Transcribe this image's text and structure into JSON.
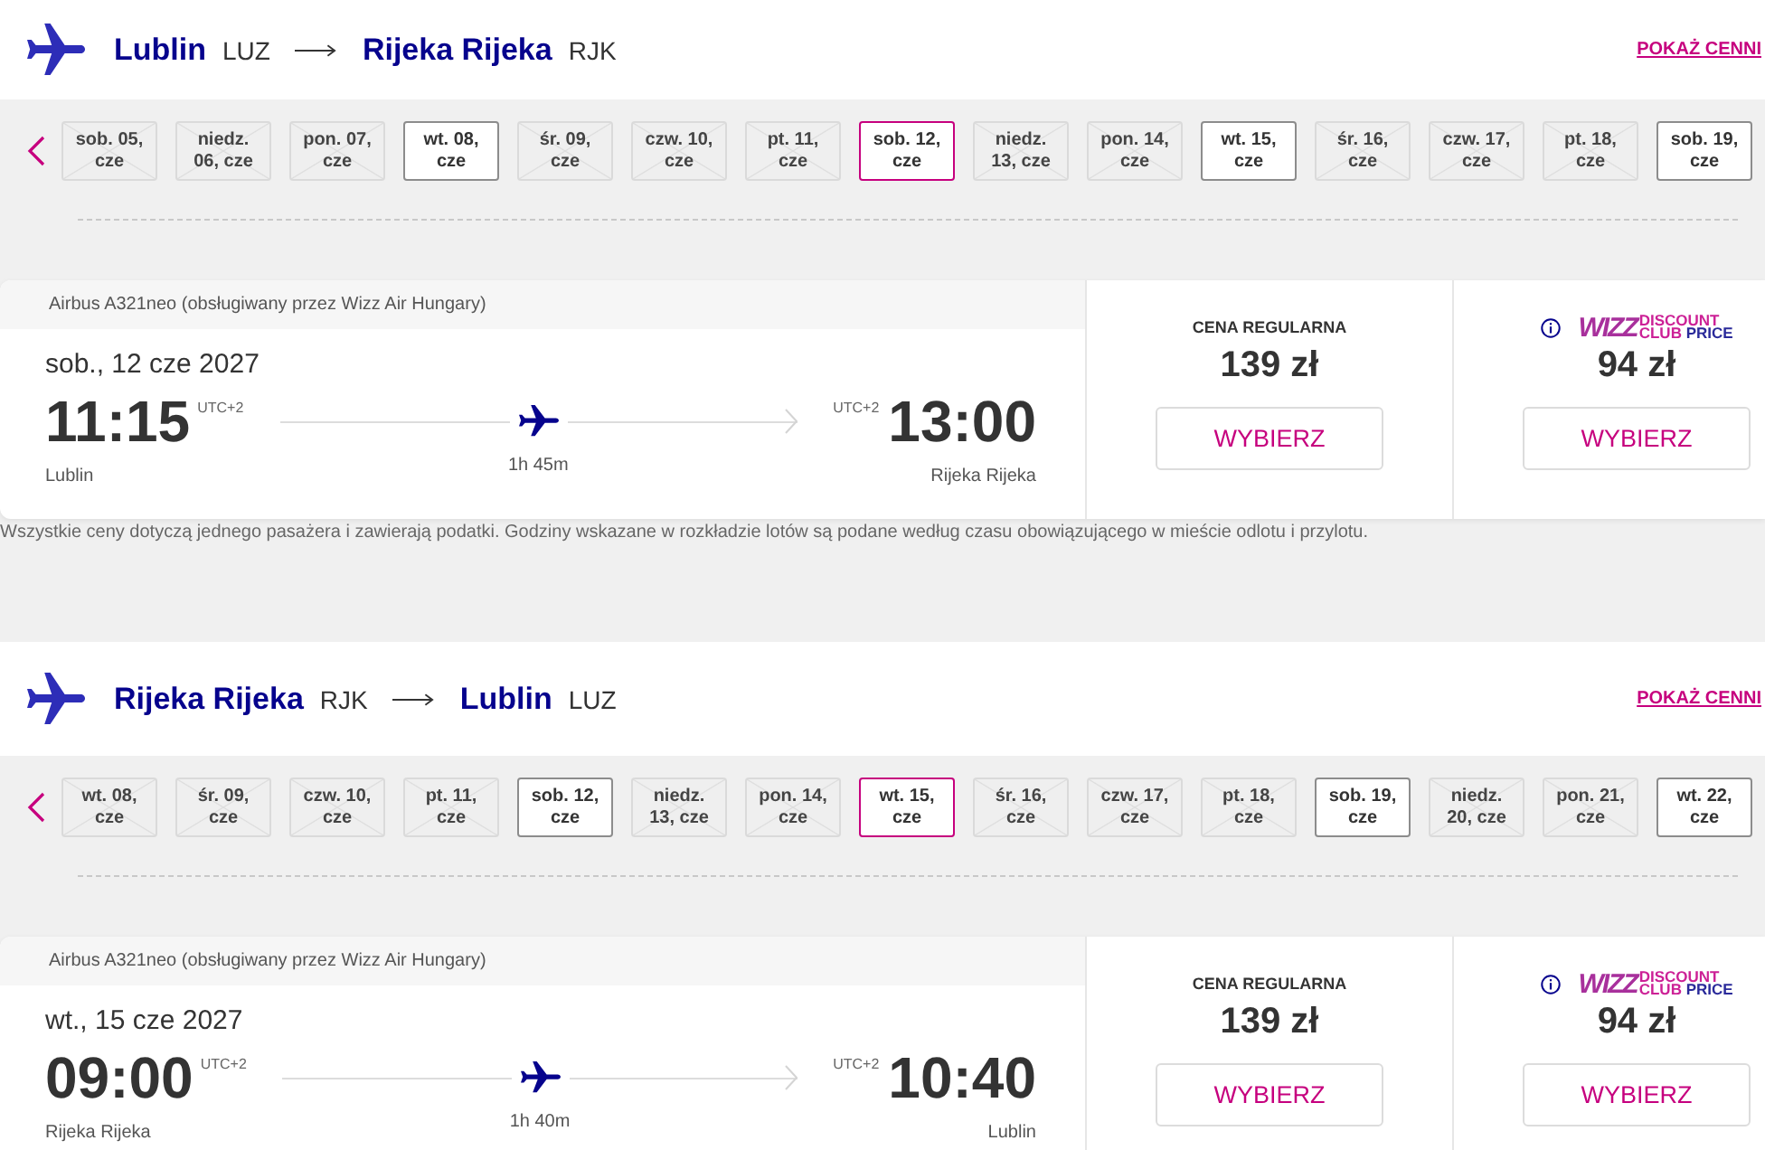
{
  "flights": [
    {
      "header": {
        "origin": {
          "city": "Lublin",
          "code": "LUZ"
        },
        "destination": {
          "city": "Rijeka Rijeka",
          "code": "RJK"
        },
        "link": "POKAŻ CENNI"
      },
      "dates": [
        {
          "label": "sob. 05, cze",
          "available": false,
          "selected": false
        },
        {
          "label": "niedz. 06, cze",
          "available": false,
          "selected": false
        },
        {
          "label": "pon. 07, cze",
          "available": false,
          "selected": false
        },
        {
          "label": "wt. 08, cze",
          "available": true,
          "selected": false
        },
        {
          "label": "śr. 09, cze",
          "available": false,
          "selected": false
        },
        {
          "label": "czw. 10, cze",
          "available": false,
          "selected": false
        },
        {
          "label": "pt. 11, cze",
          "available": false,
          "selected": false
        },
        {
          "label": "sob. 12, cze",
          "available": true,
          "selected": true
        },
        {
          "label": "niedz. 13, cze",
          "available": false,
          "selected": false
        },
        {
          "label": "pon. 14, cze",
          "available": false,
          "selected": false
        },
        {
          "label": "wt. 15, cze",
          "available": true,
          "selected": false
        },
        {
          "label": "śr. 16, cze",
          "available": false,
          "selected": false
        },
        {
          "label": "czw. 17, cze",
          "available": false,
          "selected": false
        },
        {
          "label": "pt. 18, cze",
          "available": false,
          "selected": false
        },
        {
          "label": "sob. 19, cze",
          "available": true,
          "selected": false
        }
      ],
      "card": {
        "aircraft": "Airbus A321neo (obsługiwany przez Wizz Air Hungary)",
        "date": "sob., 12 cze 2027",
        "departure": {
          "time": "11:15",
          "timezone": "UTC+2",
          "city": "Lublin"
        },
        "duration": "1h 45m",
        "arrival": {
          "time": "13:00",
          "timezone": "UTC+2",
          "city": "Rijeka Rijeka"
        },
        "fares": [
          {
            "kind": "regular",
            "label": "CENA REGULARNA",
            "price": "139 zł",
            "button": "WYBIERZ"
          },
          {
            "kind": "club",
            "logo": {
              "brand": "WIZZ",
              "lines": [
                "DISCOUNT",
                "CLUB **PRICE**"
              ]
            },
            "price": "94 zł",
            "button": "WYBIERZ"
          }
        ]
      },
      "footnote": "Wszystkie ceny dotyczą jednego pasażera i zawierają podatki. Godziny wskazane w rozkładzie lotów są podane według czasu obowiązującego w mieście odlotu i przylotu."
    },
    {
      "header": {
        "origin": {
          "city": "Rijeka Rijeka",
          "code": "RJK"
        },
        "destination": {
          "city": "Lublin",
          "code": "LUZ"
        },
        "link": "POKAŻ CENNI"
      },
      "dates": [
        {
          "label": "wt. 08, cze",
          "available": false,
          "selected": false
        },
        {
          "label": "śr. 09, cze",
          "available": false,
          "selected": false
        },
        {
          "label": "czw. 10, cze",
          "available": false,
          "selected": false
        },
        {
          "label": "pt. 11, cze",
          "available": false,
          "selected": false
        },
        {
          "label": "sob. 12, cze",
          "available": true,
          "selected": false
        },
        {
          "label": "niedz. 13, cze",
          "available": false,
          "selected": false
        },
        {
          "label": "pon. 14, cze",
          "available": false,
          "selected": false
        },
        {
          "label": "wt. 15, cze",
          "available": true,
          "selected": true
        },
        {
          "label": "śr. 16, cze",
          "available": false,
          "selected": false
        },
        {
          "label": "czw. 17, cze",
          "available": false,
          "selected": false
        },
        {
          "label": "pt. 18, cze",
          "available": false,
          "selected": false
        },
        {
          "label": "sob. 19, cze",
          "available": true,
          "selected": false
        },
        {
          "label": "niedz. 20, cze",
          "available": false,
          "selected": false
        },
        {
          "label": "pon. 21, cze",
          "available": false,
          "selected": false
        },
        {
          "label": "wt. 22, cze",
          "available": true,
          "selected": false
        }
      ],
      "card": {
        "aircraft": "Airbus A321neo (obsługiwany przez Wizz Air Hungary)",
        "date": "wt., 15 cze 2027",
        "departure": {
          "time": "09:00",
          "timezone": "UTC+2",
          "city": "Rijeka Rijeka"
        },
        "duration": "1h 40m",
        "arrival": {
          "time": "10:40",
          "timezone": "UTC+2",
          "city": "Lublin"
        },
        "fares": [
          {
            "kind": "regular",
            "label": "CENA REGULARNA",
            "price": "139 zł",
            "button": "WYBIERZ"
          },
          {
            "kind": "club",
            "logo": {
              "brand": "WIZZ",
              "lines": [
                "DISCOUNT",
                "CLUB **PRICE**"
              ]
            },
            "price": "94 zł",
            "button": "WYBIERZ"
          }
        ]
      }
    }
  ]
}
